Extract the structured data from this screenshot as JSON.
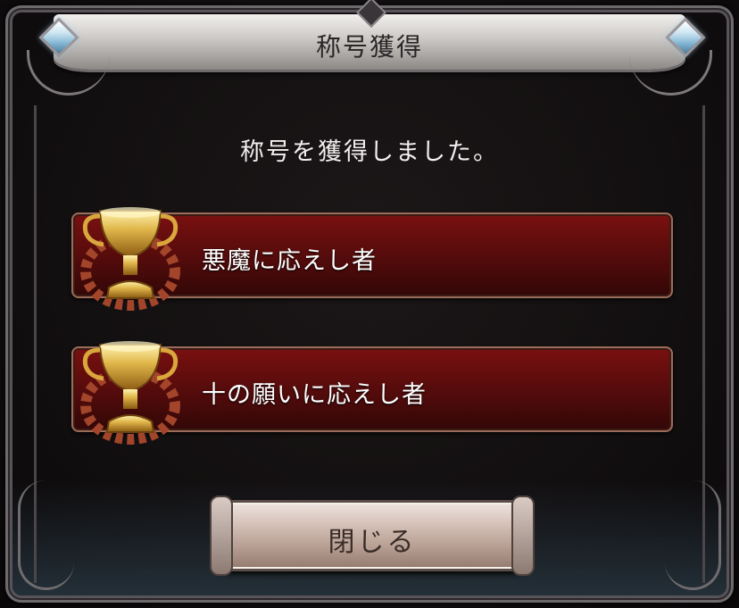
{
  "dialog": {
    "title": "称号獲得",
    "message": "称号を獲得しました。",
    "titles": [
      {
        "label": "悪魔に応えし者",
        "icon": "trophy-icon"
      },
      {
        "label": "十の願いに応えし者",
        "icon": "trophy-icon"
      }
    ],
    "close_label": "閉じる"
  },
  "colors": {
    "banner": "#cfccc9",
    "row_red": "#7a1010",
    "button": "#d3bfb6",
    "text_light": "#f1eeee"
  }
}
